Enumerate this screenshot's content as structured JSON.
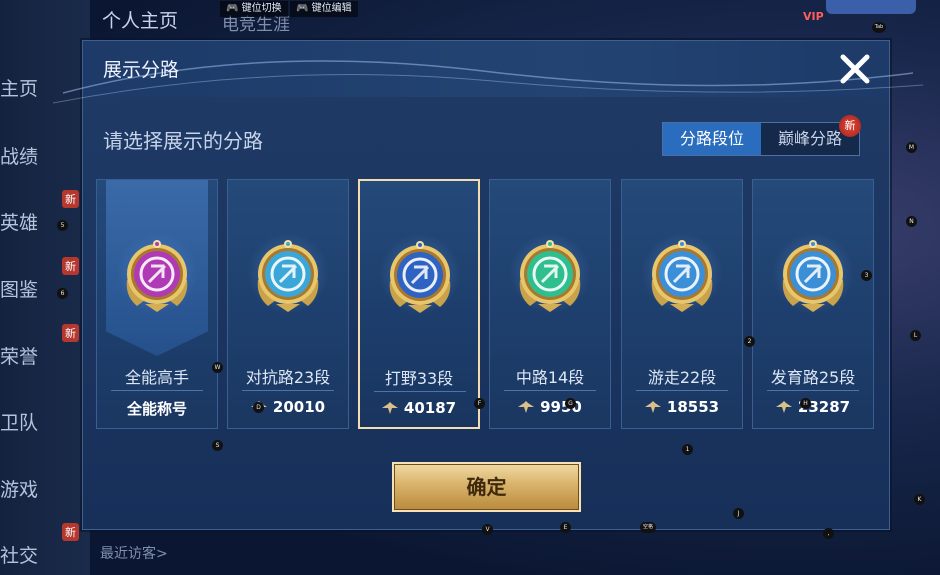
{
  "background": {
    "top_title": "个人主页",
    "top_title2": "电竞生涯",
    "hint_key_switch": "键位切换",
    "hint_key_edit": "键位编辑",
    "vip": "VIP",
    "tab_key": "Tab",
    "sidebar": [
      {
        "label": "主页"
      },
      {
        "label": "战绩"
      },
      {
        "label": "英雄",
        "badge": "新"
      },
      {
        "label": "图鉴",
        "badge": "新"
      },
      {
        "label": "荣誉",
        "badge": "新"
      },
      {
        "label": "卫队"
      },
      {
        "label": "游戏"
      },
      {
        "label": "社交",
        "badge": "新"
      }
    ],
    "recent_visitors": "最近访客>"
  },
  "dialog": {
    "title": "展示分路",
    "subtitle": "请选择展示的分路",
    "tabs": [
      {
        "label": "分路段位",
        "active": true
      },
      {
        "label": "巅峰分路",
        "active": false
      }
    ],
    "new_badge": "新",
    "cards": [
      {
        "name": "全能高手",
        "score": "全能称号",
        "color": "#b03ab6",
        "selected": false
      },
      {
        "name": "对抗路23段",
        "score": "20010",
        "color": "#3aa7d8",
        "selected": false
      },
      {
        "name": "打野33段",
        "score": "40187",
        "color": "#2e63c4",
        "selected": true
      },
      {
        "name": "中路14段",
        "score": "9950",
        "color": "#2fbf8e",
        "selected": false
      },
      {
        "name": "游走22段",
        "score": "18553",
        "color": "#3b8fd8",
        "selected": false
      },
      {
        "name": "发育路25段",
        "score": "23287",
        "color": "#3a8fd6",
        "selected": false
      }
    ],
    "confirm_label": "确定"
  },
  "key_hints": [
    "5",
    "6",
    "W",
    "S",
    "D",
    "F",
    "G",
    "H",
    "2",
    "1",
    "3",
    "M",
    "N",
    "L",
    "K",
    "J",
    "V",
    "E",
    "空格",
    ","
  ]
}
